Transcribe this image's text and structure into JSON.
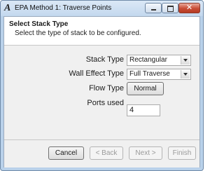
{
  "window": {
    "title": "EPA Method 1: Traverse Points",
    "app_icon_glyph": "A",
    "close_glyph": "✕"
  },
  "header": {
    "title": "Select Stack Type",
    "subtitle": "Select the type of stack to be configured."
  },
  "form": {
    "stack_type_label": "Stack Type",
    "stack_type_value": "Rectangular",
    "wall_effect_label": "Wall Effect Type",
    "wall_effect_value": "Full Traverse",
    "flow_type_label": "Flow Type",
    "flow_type_button": "Normal",
    "ports_used_label": "Ports used",
    "ports_used_value": "4"
  },
  "footer": {
    "cancel_label": "Cancel",
    "back_label": "< Back",
    "next_label": "Next >",
    "finish_label": "Finish"
  },
  "colors": {
    "titlebar": "#c9dcf0",
    "close_button": "#c84c35",
    "form_background": "#f0f0f0"
  }
}
